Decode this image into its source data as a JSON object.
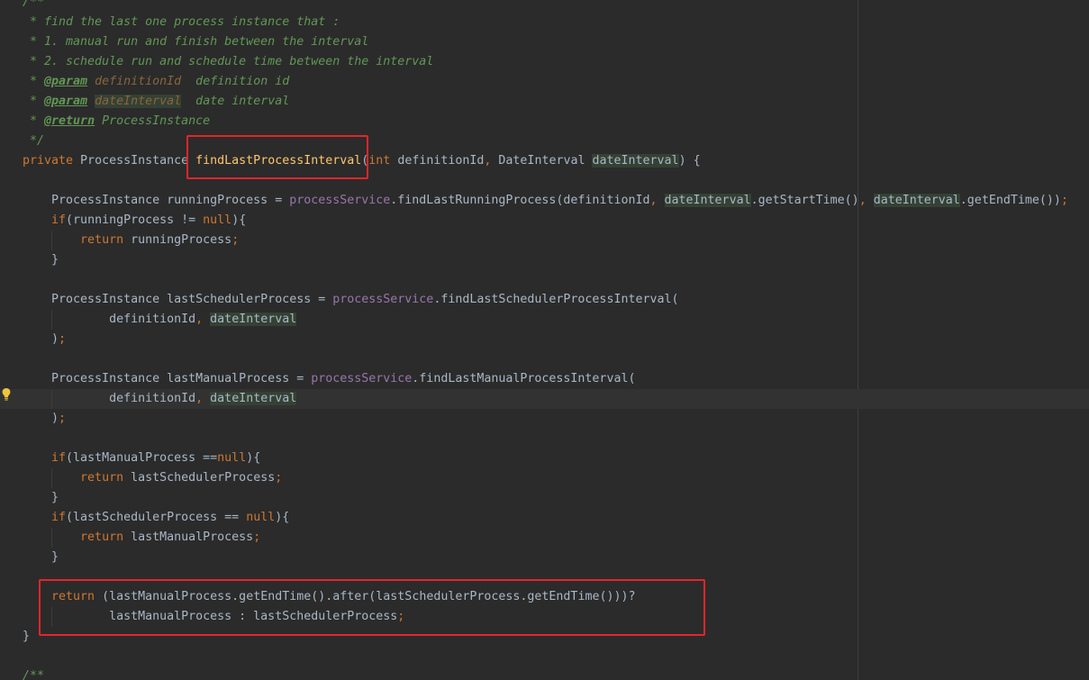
{
  "editor": {
    "lines": [
      {
        "tokens": [
          {
            "t": "/**",
            "c": "comment"
          }
        ]
      },
      {
        "tokens": [
          {
            "t": " * find the last one process instance that :",
            "c": "comment"
          }
        ]
      },
      {
        "tokens": [
          {
            "t": " * 1. manual run and finish between the interval",
            "c": "comment"
          }
        ]
      },
      {
        "tokens": [
          {
            "t": " * 2. schedule run and schedule time between the interval",
            "c": "comment"
          }
        ]
      },
      {
        "tokens": [
          {
            "t": " * ",
            "c": "comment"
          },
          {
            "t": "@param",
            "c": "doctag"
          },
          {
            "t": " ",
            "c": "comment"
          },
          {
            "t": "definitionId",
            "c": "docparam"
          },
          {
            "t": "  definition id",
            "c": "comment"
          }
        ]
      },
      {
        "tokens": [
          {
            "t": " * ",
            "c": "comment"
          },
          {
            "t": "@param",
            "c": "doctag"
          },
          {
            "t": " ",
            "c": "comment"
          },
          {
            "t": "dateInterval",
            "c": "docparam-hl"
          },
          {
            "t": "  date interval",
            "c": "comment"
          }
        ]
      },
      {
        "tokens": [
          {
            "t": " * ",
            "c": "comment"
          },
          {
            "t": "@return",
            "c": "doctag"
          },
          {
            "t": " ProcessInstance",
            "c": "comment"
          }
        ]
      },
      {
        "tokens": [
          {
            "t": " */",
            "c": "comment"
          }
        ]
      },
      {
        "tokens": [
          {
            "t": "private",
            "c": "keyword"
          },
          {
            "t": " ProcessInstance ",
            "c": "plain"
          },
          {
            "t": "findLastProcessInterval",
            "c": "method-decl"
          },
          {
            "t": "(",
            "c": "plain"
          },
          {
            "t": "int",
            "c": "keyword"
          },
          {
            "t": " definitionId",
            "c": "plain"
          },
          {
            "t": ",",
            "c": "punct"
          },
          {
            "t": " DateInterval ",
            "c": "plain"
          },
          {
            "t": "dateInterval",
            "c": "param-hl"
          },
          {
            "t": ") {",
            "c": "plain"
          }
        ]
      },
      {
        "tokens": []
      },
      {
        "tokens": [
          {
            "t": "    ProcessInstance runningProcess = ",
            "c": "plain"
          },
          {
            "t": "processService",
            "c": "field"
          },
          {
            "t": ".findLastRunningProcess(definitionId",
            "c": "plain"
          },
          {
            "t": ",",
            "c": "punct"
          },
          {
            "t": " ",
            "c": "plain"
          },
          {
            "t": "dateInterval",
            "c": "param-hl"
          },
          {
            "t": ".getStartTime()",
            "c": "plain"
          },
          {
            "t": ",",
            "c": "punct"
          },
          {
            "t": " ",
            "c": "plain"
          },
          {
            "t": "dateInterval",
            "c": "param-hl"
          },
          {
            "t": ".getEndTime())",
            "c": "plain"
          },
          {
            "t": ";",
            "c": "punct"
          }
        ]
      },
      {
        "tokens": [
          {
            "t": "    ",
            "c": "plain"
          },
          {
            "t": "if",
            "c": "keyword"
          },
          {
            "t": "(runningProcess != ",
            "c": "plain"
          },
          {
            "t": "null",
            "c": "keyword"
          },
          {
            "t": "){",
            "c": "plain"
          }
        ]
      },
      {
        "tokens": [
          {
            "t": "        ",
            "c": "plain"
          },
          {
            "t": "return",
            "c": "keyword"
          },
          {
            "t": " runningProcess",
            "c": "plain"
          },
          {
            "t": ";",
            "c": "punct"
          }
        ]
      },
      {
        "tokens": [
          {
            "t": "    }",
            "c": "plain"
          }
        ]
      },
      {
        "tokens": []
      },
      {
        "tokens": [
          {
            "t": "    ProcessInstance lastSchedulerProcess = ",
            "c": "plain"
          },
          {
            "t": "processService",
            "c": "field"
          },
          {
            "t": ".findLastSchedulerProcessInterval(",
            "c": "plain"
          }
        ]
      },
      {
        "tokens": [
          {
            "t": "            definitionId",
            "c": "plain"
          },
          {
            "t": ",",
            "c": "punct"
          },
          {
            "t": " ",
            "c": "plain"
          },
          {
            "t": "dateInterval",
            "c": "param-hl"
          }
        ]
      },
      {
        "tokens": [
          {
            "t": "    )",
            "c": "plain"
          },
          {
            "t": ";",
            "c": "punct"
          }
        ]
      },
      {
        "tokens": []
      },
      {
        "tokens": [
          {
            "t": "    ProcessInstance lastManualProcess = ",
            "c": "plain"
          },
          {
            "t": "processService",
            "c": "field"
          },
          {
            "t": ".findLastManualProcessInterval(",
            "c": "plain"
          }
        ]
      },
      {
        "tokens": [
          {
            "t": "            definitionId",
            "c": "plain"
          },
          {
            "t": ",",
            "c": "punct"
          },
          {
            "t": " ",
            "c": "plain"
          },
          {
            "t": "dateInterval",
            "c": "param-hl"
          }
        ],
        "current": true
      },
      {
        "tokens": [
          {
            "t": "    )",
            "c": "plain"
          },
          {
            "t": ";",
            "c": "punct"
          }
        ]
      },
      {
        "tokens": []
      },
      {
        "tokens": [
          {
            "t": "    ",
            "c": "plain"
          },
          {
            "t": "if",
            "c": "keyword"
          },
          {
            "t": "(lastManualProcess ==",
            "c": "plain"
          },
          {
            "t": "null",
            "c": "keyword"
          },
          {
            "t": "){",
            "c": "plain"
          }
        ]
      },
      {
        "tokens": [
          {
            "t": "        ",
            "c": "plain"
          },
          {
            "t": "return",
            "c": "keyword"
          },
          {
            "t": " lastSchedulerProcess",
            "c": "plain"
          },
          {
            "t": ";",
            "c": "punct"
          }
        ]
      },
      {
        "tokens": [
          {
            "t": "    }",
            "c": "plain"
          }
        ]
      },
      {
        "tokens": [
          {
            "t": "    ",
            "c": "plain"
          },
          {
            "t": "if",
            "c": "keyword"
          },
          {
            "t": "(lastSchedulerProcess == ",
            "c": "plain"
          },
          {
            "t": "null",
            "c": "keyword"
          },
          {
            "t": "){",
            "c": "plain"
          }
        ]
      },
      {
        "tokens": [
          {
            "t": "        ",
            "c": "plain"
          },
          {
            "t": "return",
            "c": "keyword"
          },
          {
            "t": " lastManualProcess",
            "c": "plain"
          },
          {
            "t": ";",
            "c": "punct"
          }
        ]
      },
      {
        "tokens": [
          {
            "t": "    }",
            "c": "plain"
          }
        ]
      },
      {
        "tokens": []
      },
      {
        "tokens": [
          {
            "t": "    ",
            "c": "plain"
          },
          {
            "t": "return",
            "c": "keyword"
          },
          {
            "t": " (lastManualProcess.getEndTime().after(lastSchedulerProcess.getEndTime()))?",
            "c": "plain"
          }
        ]
      },
      {
        "tokens": [
          {
            "t": "            lastManualProcess : lastSchedulerProcess",
            "c": "plain"
          },
          {
            "t": ";",
            "c": "punct"
          }
        ]
      },
      {
        "tokens": [
          {
            "t": "}",
            "c": "plain"
          }
        ]
      },
      {
        "tokens": []
      },
      {
        "tokens": [
          {
            "t": "/**",
            "c": "comment"
          }
        ]
      }
    ],
    "intention_icon": "lightbulb-icon",
    "colors": {
      "background": "#2b2b2b",
      "keyword": "#cc7832",
      "comment": "#629755",
      "method_declaration": "#ffc66d",
      "field": "#9876aa",
      "highlight": "#344134",
      "annotation_box": "#e5252a"
    }
  }
}
